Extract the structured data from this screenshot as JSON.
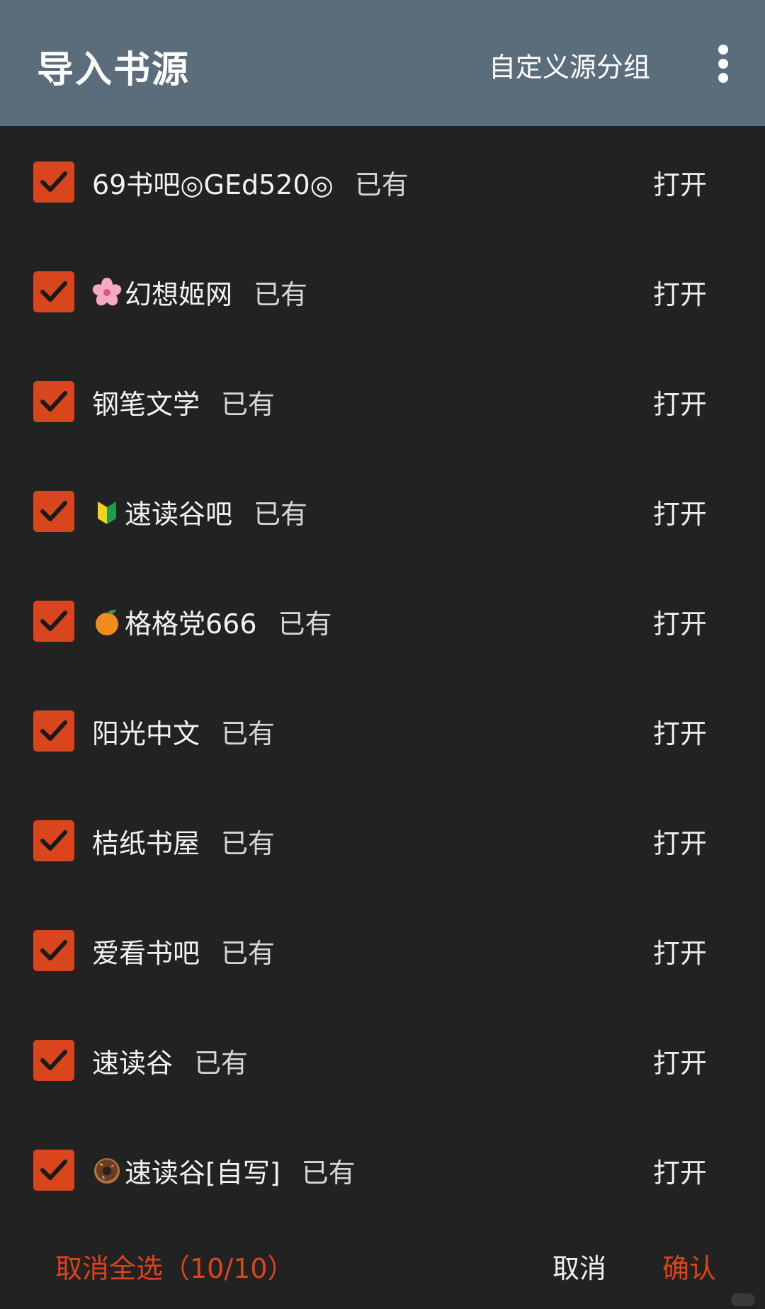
{
  "toolbar": {
    "title": "导入书源",
    "group_button_label": "自定义源分组",
    "more_icon": "more-vertical-icon",
    "background_color": "#5b6d7b"
  },
  "accent_color": "#d9451c",
  "sources": [
    {
      "checked": true,
      "emoji": null,
      "name": "69书吧◎GEd520◎",
      "status": "已有",
      "open_label": "打开"
    },
    {
      "checked": true,
      "emoji": "cherry-blossom-icon",
      "name": "幻想姬网",
      "status": "已有",
      "open_label": "打开"
    },
    {
      "checked": true,
      "emoji": null,
      "name": "钢笔文学",
      "status": "已有",
      "open_label": "打开"
    },
    {
      "checked": true,
      "emoji": "beginner-symbol-icon",
      "name": " 速读谷吧",
      "status": "已有",
      "open_label": "打开"
    },
    {
      "checked": true,
      "emoji": "tangerine-icon",
      "name": "格格党666",
      "status": "已有",
      "open_label": "打开"
    },
    {
      "checked": true,
      "emoji": null,
      "name": "阳光中文",
      "status": "已有",
      "open_label": "打开"
    },
    {
      "checked": true,
      "emoji": null,
      "name": "桔纸书屋",
      "status": "已有",
      "open_label": "打开"
    },
    {
      "checked": true,
      "emoji": null,
      "name": "爱看书吧",
      "status": "已有",
      "open_label": "打开"
    },
    {
      "checked": true,
      "emoji": null,
      "name": "速读谷",
      "status": "已有",
      "open_label": "打开"
    },
    {
      "checked": true,
      "emoji": "doughnut-icon",
      "name": "速读谷[自写]",
      "status": "已有",
      "open_label": "打开"
    }
  ],
  "footer": {
    "deselect_all_label": "取消全选（10/10）",
    "cancel_label": "取消",
    "confirm_label": "确认"
  }
}
